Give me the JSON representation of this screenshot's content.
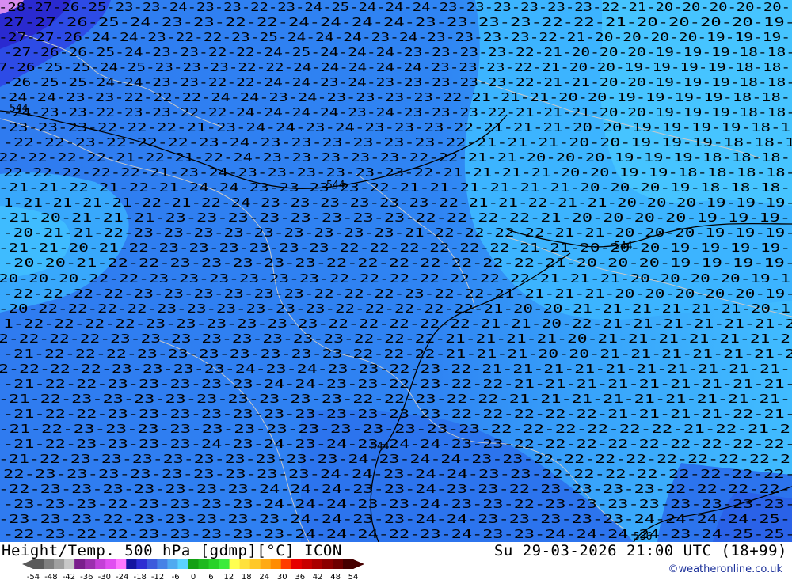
{
  "title": {
    "left": "Height/Temp. 500 hPa [gdmp][°C] ICON",
    "right": "Su 29-03-2026 21:00 UTC (18+99)"
  },
  "credit": "©weatheronline.co.uk",
  "legend": {
    "ticks": [
      "-54",
      "-48",
      "-42",
      "-36",
      "-30",
      "-24",
      "-18",
      "-12",
      "-6",
      "0",
      "6",
      "12",
      "18",
      "24",
      "30",
      "36",
      "42",
      "48",
      "54"
    ],
    "colors": [
      "#5a5a5a",
      "#7f7f7f",
      "#a0a0a0",
      "#c8c8c8",
      "#7a1e8c",
      "#9b2fae",
      "#c33fd6",
      "#e04ff0",
      "#ff78ff",
      "#1414a0",
      "#2d2dd2",
      "#3c5adc",
      "#4682e6",
      "#50aaf0",
      "#5ad2ff",
      "#14a014",
      "#1eb91e",
      "#28d228",
      "#3ceb3c",
      "#ffff50",
      "#ffe13c",
      "#ffc828",
      "#ffaa14",
      "#ff8c00",
      "#ff3c00",
      "#e60000",
      "#c80000",
      "#aa0000",
      "#8c0000",
      "#6e0000",
      "#460000"
    ]
  },
  "map": {
    "colors": {
      "bg_dark": "#2f7bf0",
      "bg_mid": "#2f8cf5",
      "bg_light": "#3cb4ff",
      "bg_cyan": "#46c8ff",
      "nw_corner": "#2d4be6",
      "label_black": "#000000",
      "label_magenta": "#b400b4",
      "coast": "#c8c8c8",
      "contour": "#000000"
    },
    "rows": [
      "-28-27-26-25-23-23-24-23-23-22-23-24-25-24-24-24-23-23-23-23-23-23-22-21-20-20-20-20-20-",
      "27-27-26-25-24-23-23-22-22-24-24-24-24-23-23-23-23-22-22-21-20-20-20-20-19-",
      "-27-27-26-24-24-23-22-22-23-25-24-24-24-23-24-23-23-23-23-22-21-20-20-20-20-19-19-19-",
      "-27-26-26-25-24-23-23-22-22-24-25-24-24-24-23-23-23-23-22-21-20-20-20-19-19-19-18-18-",
      "7-26-25-25-24-25-23-23-23-22-22-24-24-24-24-24-23-23-23-22-21-20-20-19-19-19-19-18-18-",
      "-26-25-25-24-24-23-23-22-22-24-24-23-24-23-23-23-23-23-22-21-21-20-20-19-19-19-18-18-",
      "-24-24-23-23-22-22-22-24-24-23-24-23-23-23-23-22-21-21-21-20-20-19-19-19-19-18-18-",
      "-24-23-23-22-23-23-22-22-24-24-24-24-23-24-23-23-23-22-21-21-21-20-20-19-19-19-18-18-",
      "-23-23-23-22-22-22-21-23-24-24-23-24-23-23-23-22-21-21-21-20-20-19-19-19-19-18-1",
      "-22-22-23-22-22-22-23-24-23-23-23-23-23-23-22-21-21-21-20-20-19-19-19-18-18-1",
      "22-22-22-22-21-22-21-22-24-23-23-23-23-23-22-22-21-21-20-20-20-19-19-19-18-18-18-",
      "22-22-22-22-22-21-23-24-23-23-23-23-23-23-22-21-21-21-21-20-20-19-19-18-18-18-18-",
      "-21-21-22-21-22-21-24-24-23-23-23-23-22-21-21-21-21-21-21-20-20-20-19-18-18-18-",
      "1-21-21-21-21-22-21-22-24-23-23-23-23-23-23-22-21-21-22-21-21-20-20-20-19-19-19-",
      "-21-20-21-21-21-23-23-23-23-23-23-23-23-22-22-22-22-21-20-20-20-20-19-19-19-",
      "-20-21-21-22-23-23-23-23-23-23-23-23-23-21-22-22-22-22-21-21-20-20-20-19-19-19-",
      "-21-21-20-21-22-23-23-23-23-23-23-22-22-22-22-22-22-21-21-20-20-20-19-19-19-19-",
      "-20-20-21-22-22-23-23-23-23-23-22-22-22-22-22-22-22-21-20-20-20-19-19-19-19-",
      "20-20-20-22-22-23-23-23-23-23-23-22-22-22-22-22-22-22-21-21-21-20-20-20-20-19-1",
      "-22-22-22-22-23-23-23-23-23-23-22-22-22-23-22-22-21-21-21-21-20-20-20-20-20-19-",
      "-20-22-22-22-22-23-23-23-23-23-23-22-22-22-22-22-21-20-20-21-21-21-21-21-21-20-1",
      "1-22-22-22-22-23-23-23-23-23-23-22-22-22-22-22-21-21-20-22-21-21-21-21-21-21-2",
      "2-22-22-22-23-23-23-23-23-23-23-23-22-22-22-21-21-21-21-20-21-21-21-21-21-21-2",
      "-21-22-22-22-23-23-23-23-23-23-23-22-22-22-21-21-21-20-20-21-21-21-21-21-21-2",
      "2-22-22-22-23-23-23-23-24-23-24-23-23-22-23-22-21-21-21-21-21-21-21-21-21-21-",
      "-21-22-22-23-23-23-23-23-24-24-23-23-22-23-22-22-21-21-21-21-21-21-21-21-21-",
      "-21-22-23-23-23-23-23-23-23-23-23-22-22-23-22-22-21-21-21-21-21-21-21-21-21-",
      "-21-22-22-23-23-23-23-23-23-23-23-23-23-23-22-22-22-22-22-21-21-21-21-22-21-",
      "-21-22-23-23-23-23-23-23-23-23-23-23-23-23-23-22-22-22-22-22-22-21-22-21-2",
      "-21-22-23-23-23-23-24-23-24-23-24-23-24-24-23-23-22-22-22-22-22-22-22-22-22-",
      "-21-22-23-23-23-23-23-23-23-23-23-24-23-24-24-23-23-22-22-22-22-22-22-22-22-2",
      "22-23-23-23-23-23-23-23-23-23-24-24-23-24-24-23-23-22-22-22-22-22-22-22-22-",
      "-22-23-23-23-23-23-23-23-24-24-24-23-23-24-23-23-22-23-23-23-23-22-22-22-22-",
      "-23-23-23-22-23-23-23-23-24-24-24-23-23-24-23-23-22-23-23-23-23-23-23-23-23-",
      "-23-23-23-22-23-23-23-23-23-24-24-23-23-24-24-23-23-23-23-23-24-24-24-24-25-",
      "-22-23-22-22-23-23-23-23-23-24-24-24-22-23-24-23-23-24-24-24-24-23-24-25-25-"
    ],
    "contour_labels": [
      "544",
      "544",
      "544",
      "544",
      "536"
    ]
  }
}
